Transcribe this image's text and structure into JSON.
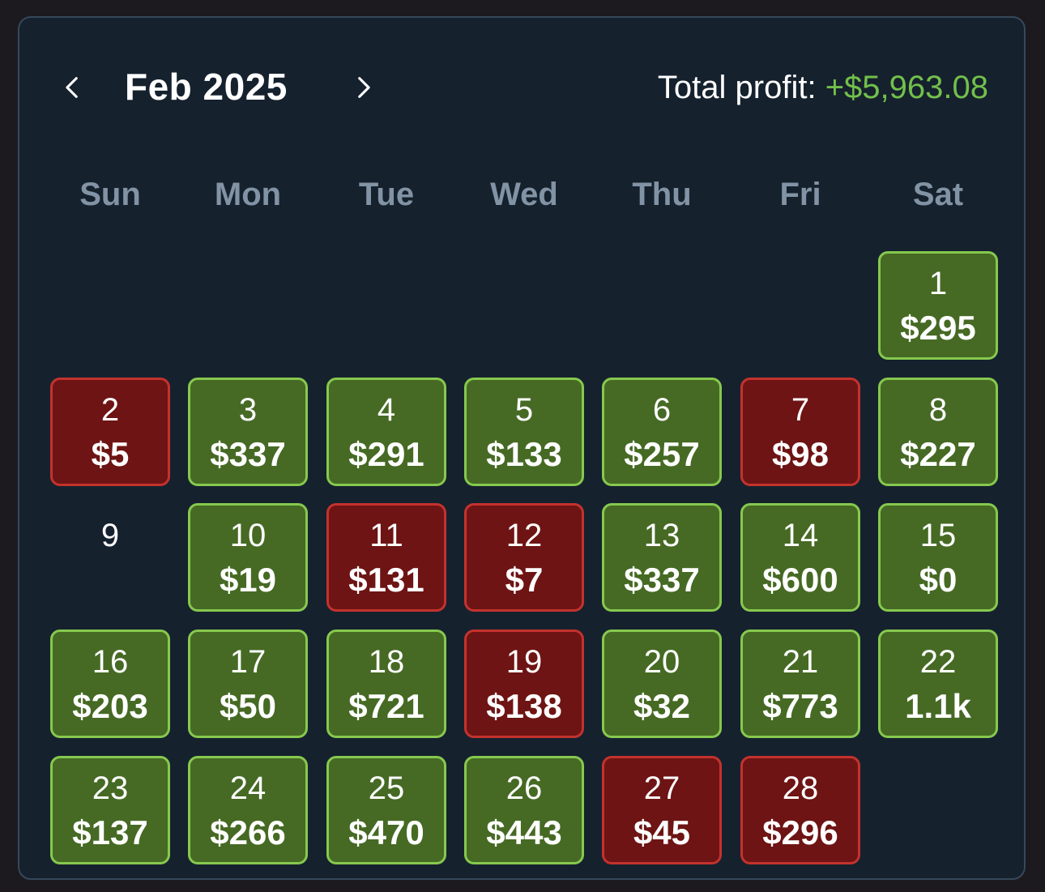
{
  "header": {
    "month_title": "Feb 2025",
    "total_label": "Total profit:",
    "total_value": "+$5,963.08",
    "prev_icon": "chevron-left-icon",
    "next_icon": "chevron-right-icon"
  },
  "colors": {
    "panel_bg": "#16212e",
    "profit_green": "#72c04a",
    "positive_fill": "#466a24",
    "positive_border": "#86c94e",
    "negative_fill": "#6e1414",
    "negative_border": "#c4322d",
    "weekday_text": "#8193a4"
  },
  "weekdays": [
    "Sun",
    "Mon",
    "Tue",
    "Wed",
    "Thu",
    "Fri",
    "Sat"
  ],
  "first_weekday_index": 6,
  "days": [
    {
      "day": "1",
      "amount": "$295",
      "result": "profit"
    },
    {
      "day": "2",
      "amount": "$5",
      "result": "loss"
    },
    {
      "day": "3",
      "amount": "$337",
      "result": "profit"
    },
    {
      "day": "4",
      "amount": "$291",
      "result": "profit"
    },
    {
      "day": "5",
      "amount": "$133",
      "result": "profit"
    },
    {
      "day": "6",
      "amount": "$257",
      "result": "profit"
    },
    {
      "day": "7",
      "amount": "$98",
      "result": "loss"
    },
    {
      "day": "8",
      "amount": "$227",
      "result": "profit"
    },
    {
      "day": "9",
      "amount": "",
      "result": "none"
    },
    {
      "day": "10",
      "amount": "$19",
      "result": "profit"
    },
    {
      "day": "11",
      "amount": "$131",
      "result": "loss"
    },
    {
      "day": "12",
      "amount": "$7",
      "result": "loss"
    },
    {
      "day": "13",
      "amount": "$337",
      "result": "profit"
    },
    {
      "day": "14",
      "amount": "$600",
      "result": "profit"
    },
    {
      "day": "15",
      "amount": "$0",
      "result": "profit"
    },
    {
      "day": "16",
      "amount": "$203",
      "result": "profit"
    },
    {
      "day": "17",
      "amount": "$50",
      "result": "profit"
    },
    {
      "day": "18",
      "amount": "$721",
      "result": "profit"
    },
    {
      "day": "19",
      "amount": "$138",
      "result": "loss"
    },
    {
      "day": "20",
      "amount": "$32",
      "result": "profit"
    },
    {
      "day": "21",
      "amount": "$773",
      "result": "profit"
    },
    {
      "day": "22",
      "amount": "1.1k",
      "result": "profit"
    },
    {
      "day": "23",
      "amount": "$137",
      "result": "profit"
    },
    {
      "day": "24",
      "amount": "$266",
      "result": "profit"
    },
    {
      "day": "25",
      "amount": "$470",
      "result": "profit"
    },
    {
      "day": "26",
      "amount": "$443",
      "result": "profit"
    },
    {
      "day": "27",
      "amount": "$45",
      "result": "loss"
    },
    {
      "day": "28",
      "amount": "$296",
      "result": "loss"
    }
  ]
}
